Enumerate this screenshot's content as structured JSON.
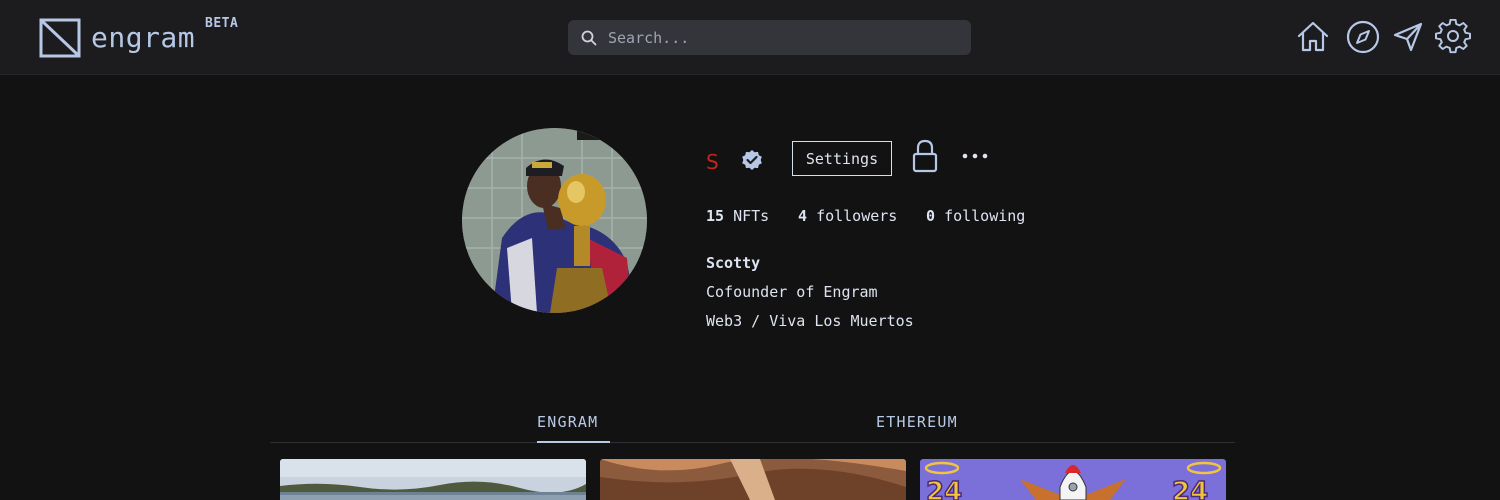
{
  "header": {
    "logo_text": "engram",
    "beta_label": "BETA",
    "search_placeholder": "Search...",
    "nav_icons": [
      "home-icon",
      "explore-compass-icon",
      "send-icon",
      "settings-gear-icon"
    ]
  },
  "profile": {
    "username": "S",
    "username_color": "#c0251e",
    "verified": true,
    "settings_label": "Settings",
    "stats": [
      {
        "value": "15",
        "label": "NFTs"
      },
      {
        "value": "4",
        "label": "followers"
      },
      {
        "value": "0",
        "label": "following"
      }
    ],
    "display_name": "Scotty",
    "bio_lines": [
      "Cofounder of Engram",
      "Web3 / Viva Los Muertos"
    ]
  },
  "tabs": [
    {
      "label": "ENGRAM",
      "active": true
    },
    {
      "label": "ETHEREUM",
      "active": false
    }
  ],
  "colors": {
    "background": "#121212",
    "header": "#1c1c1f",
    "accent": "#b8c9e6",
    "text": "#dde3f0"
  }
}
